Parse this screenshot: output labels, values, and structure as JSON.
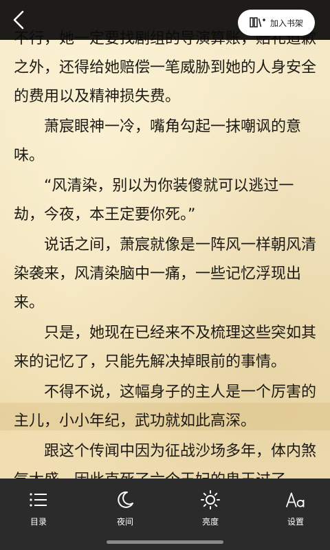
{
  "header": {
    "back_icon": "chevron-left-icon",
    "add_shelf_label": "加入书架",
    "add_shelf_icon": "bookshelf-add-icon"
  },
  "content": {
    "paragraphs": [
      "不行，她一定要找剧组的导演算账，赔礼道歉之外，还得给她赔偿一笔威胁到她的人身安全的费用以及精神损失费。",
      "萧宸眼神一冷，嘴角勾起一抹嘲讽的意味。",
      "“风清染，别以为你装傻就可以逃过一劫，今夜，本王定要你死。”",
      "说话之间，萧宸就像是一阵风一样朝风清染袭来，风清染脑中一痛，一些记忆浮现出来。",
      "只是，她现在已经来不及梳理这些突如其来的记忆了，只能先解决掉眼前的事情。",
      "不得不说，这幅身子的主人是一个厉害的主儿，小小年纪，武功就如此高深。",
      "跟这个传闻中因为征战沙场多年，体内煞气太盛，因此克死了六个王妃的鬼王过了"
    ]
  },
  "toolbar": {
    "items": [
      {
        "label": "目录",
        "icon": "list-icon"
      },
      {
        "label": "夜间",
        "icon": "moon-icon"
      },
      {
        "label": "亮度",
        "icon": "sun-icon"
      },
      {
        "label": "设置",
        "icon": "font-icon"
      }
    ]
  },
  "colors": {
    "paper": "#f3e6c3",
    "text": "#1d1a14",
    "bars": "#2b2b2b"
  }
}
